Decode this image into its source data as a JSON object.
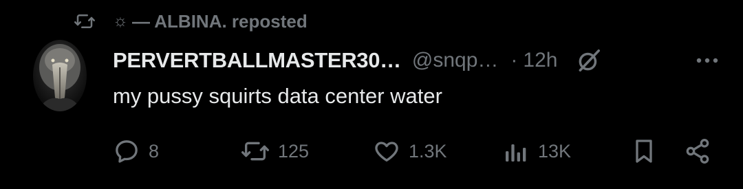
{
  "repost": {
    "icon": "repost-icon",
    "name_prefix": "☼",
    "reposter_text": "— ALBINA. reposted"
  },
  "post": {
    "avatar": "avatar",
    "display_name": "PERVERTBALLMASTER30…",
    "handle": "@snqp…",
    "separator": "·",
    "time": "12h",
    "text": "my pussy squirts data center water"
  },
  "actions": {
    "replies": "8",
    "reposts": "125",
    "likes": "1.3K",
    "views": "13K"
  },
  "colors": {
    "background": "#000000",
    "primary_text": "#e7e9ea",
    "secondary_text": "#71767b"
  }
}
